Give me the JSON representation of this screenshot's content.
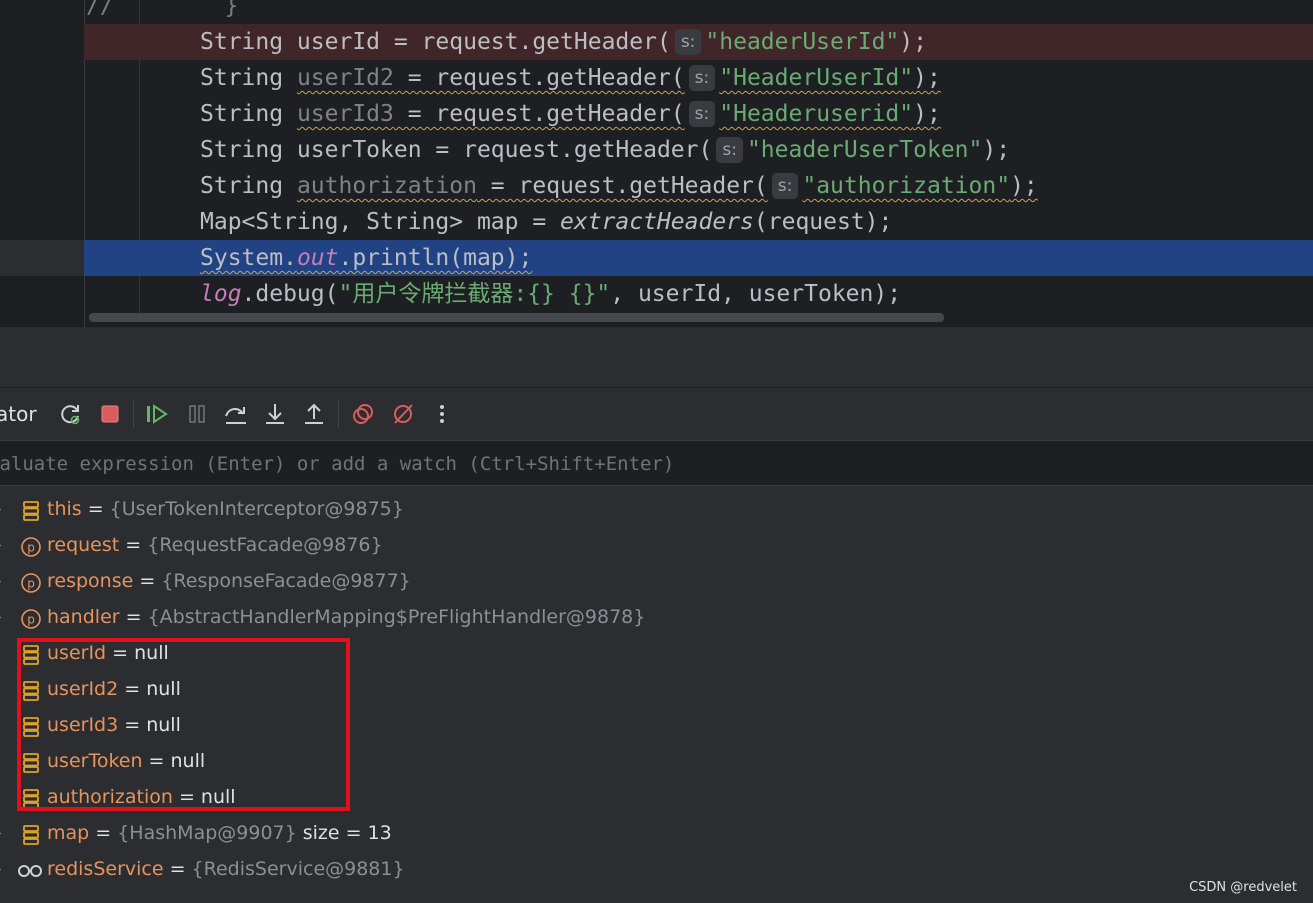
{
  "editor": {
    "comment_line": "//        }",
    "lines": [
      {
        "pre": "String userId = request.getHeader(",
        "hint": "s:",
        "str": "\"headerUserId\"",
        "post": ");"
      },
      {
        "pre_a": "String ",
        "warn_var": "userId2",
        "pre_b": " = request.getHeader(",
        "hint": "s:",
        "str": "\"HeaderUserId\"",
        "post": ");"
      },
      {
        "pre_a": "String ",
        "warn_var": "userId3",
        "pre_b": " = request.getHeader(",
        "hint": "s:",
        "str": "\"Headeruserid\"",
        "post": ");"
      },
      {
        "pre": "String userToken = request.getHeader(",
        "hint": "s:",
        "str": "\"headerUserToken\"",
        "post": ");"
      },
      {
        "pre_a": "String ",
        "warn_var": "authorization",
        "pre_b": " = request.getHeader(",
        "hint": "s:",
        "str": "\"authorization\"",
        "post": ");"
      },
      {
        "a": "Map<String, String> map = ",
        "method": "extractHeaders",
        "b": "(request);"
      },
      {
        "a": "System.",
        "field": "out",
        "b": ".println(map);"
      },
      {
        "method": "log",
        "a": ".debug(",
        "str": "\"用户令牌拦截器:{} {}\"",
        "b": ", userId, userToken);"
      }
    ]
  },
  "debug": {
    "tool_title": "ator",
    "expression_placeholder": "valuate expression (Enter) or add a watch (Ctrl+Shift+Enter)",
    "toolbar_buttons": [
      "rerun-icon",
      "stop-icon",
      "resume-icon",
      "pause-icon",
      "step-over-icon",
      "step-into-icon",
      "step-out-icon",
      "view-breakpoints-icon",
      "mute-breakpoints-icon",
      "more-icon"
    ],
    "variables": [
      {
        "icon": "field-icon",
        "name": "this",
        "eq": " = ",
        "value": "{UserTokenInterceptor@9875}",
        "extra": "",
        "expandable": true
      },
      {
        "icon": "parameter-icon",
        "name": "request",
        "eq": " = ",
        "value": "{RequestFacade@9876}",
        "extra": "",
        "expandable": true
      },
      {
        "icon": "parameter-icon",
        "name": "response",
        "eq": " = ",
        "value": "{ResponseFacade@9877}",
        "extra": "",
        "expandable": true
      },
      {
        "icon": "parameter-icon",
        "name": "handler",
        "eq": " = ",
        "value": "{AbstractHandlerMapping$PreFlightHandler@9878}",
        "extra": "",
        "expandable": true
      },
      {
        "icon": "field-icon",
        "name": "userId",
        "eq": " = ",
        "value": "null",
        "extra": "",
        "expandable": false
      },
      {
        "icon": "field-icon",
        "name": "userId2",
        "eq": " = ",
        "value": "null",
        "extra": "",
        "expandable": false
      },
      {
        "icon": "field-icon",
        "name": "userId3",
        "eq": " = ",
        "value": "null",
        "extra": "",
        "expandable": false
      },
      {
        "icon": "field-icon",
        "name": "userToken",
        "eq": " = ",
        "value": "null",
        "extra": "",
        "expandable": false
      },
      {
        "icon": "field-icon",
        "name": "authorization",
        "eq": " = ",
        "value": "null",
        "extra": "",
        "expandable": false
      },
      {
        "icon": "field-icon",
        "name": "map",
        "eq": " = ",
        "value": "{HashMap@9907}",
        "extra": " size = 13",
        "expandable": true
      },
      {
        "icon": "watch-icon",
        "name": "redisService",
        "eq": " = ",
        "value": "{RedisService@9881}",
        "extra": "",
        "expandable": true
      }
    ]
  },
  "watermark": "CSDN @redvelet",
  "colors": {
    "highlight_box": "#e0111a",
    "current_line": "#214283",
    "breakpoint_line": "#402628"
  }
}
